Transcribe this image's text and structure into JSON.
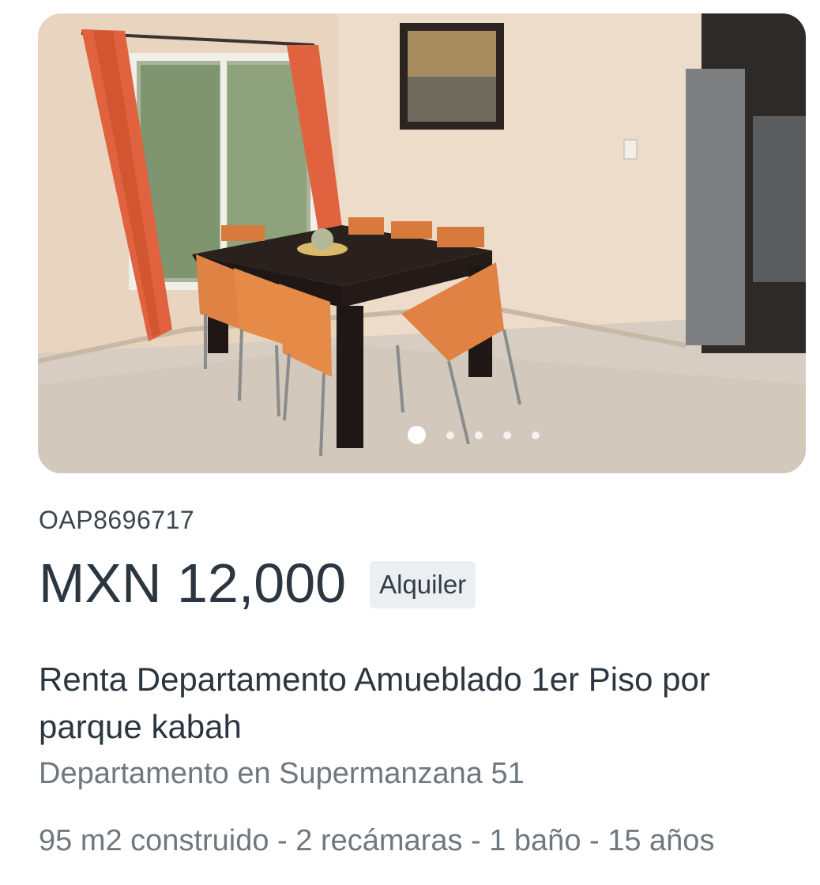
{
  "listing": {
    "code": "OAP8696717",
    "price": "MXN 12,000",
    "operation_badge": "Alquiler",
    "title": "Renta Departamento Amueblado 1er Piso por parque kabah",
    "location": "Departamento en Supermanzana 51",
    "specs": "95 m2 construido - 2 recámaras - 1 baño - 15 años"
  },
  "gallery": {
    "photo_subject": "furnished dining room with table and orange chairs",
    "total_images": 5,
    "active_index": 0
  },
  "colors": {
    "text_primary": "#2b3640",
    "text_secondary": "#6e7880",
    "badge_bg": "#eceff1"
  }
}
